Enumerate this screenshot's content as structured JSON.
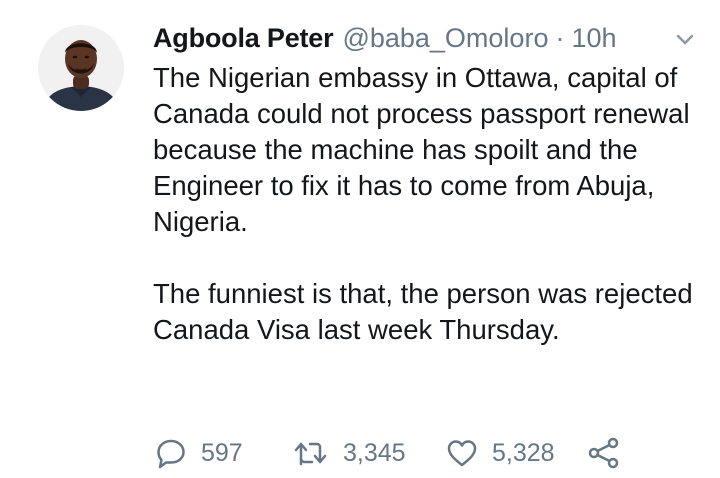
{
  "tweet": {
    "author": {
      "name": "Agboola Peter",
      "handle": "@baba_Omoloro",
      "avatar": "profile-photo"
    },
    "separator": "·",
    "time": "10h",
    "menu_icon": "chevron-down-icon",
    "paragraphs": [
      "The Nigerian embassy in Ottawa, capital of Canada could not process passport renewal because the machine has spoilt and the Engineer to fix it has to come from Abuja, Nigeria.",
      "The funniest is that, the person was rejected Canada Visa last week Thursday."
    ],
    "actions": {
      "reply": {
        "icon": "reply-icon",
        "count": "597"
      },
      "retweet": {
        "icon": "retweet-icon",
        "count": "3,345"
      },
      "like": {
        "icon": "heart-icon",
        "count": "5,328"
      },
      "share": {
        "icon": "share-icon"
      }
    }
  },
  "colors": {
    "text_primary": "#14171a",
    "text_secondary": "#657786",
    "background": "#ffffff"
  }
}
